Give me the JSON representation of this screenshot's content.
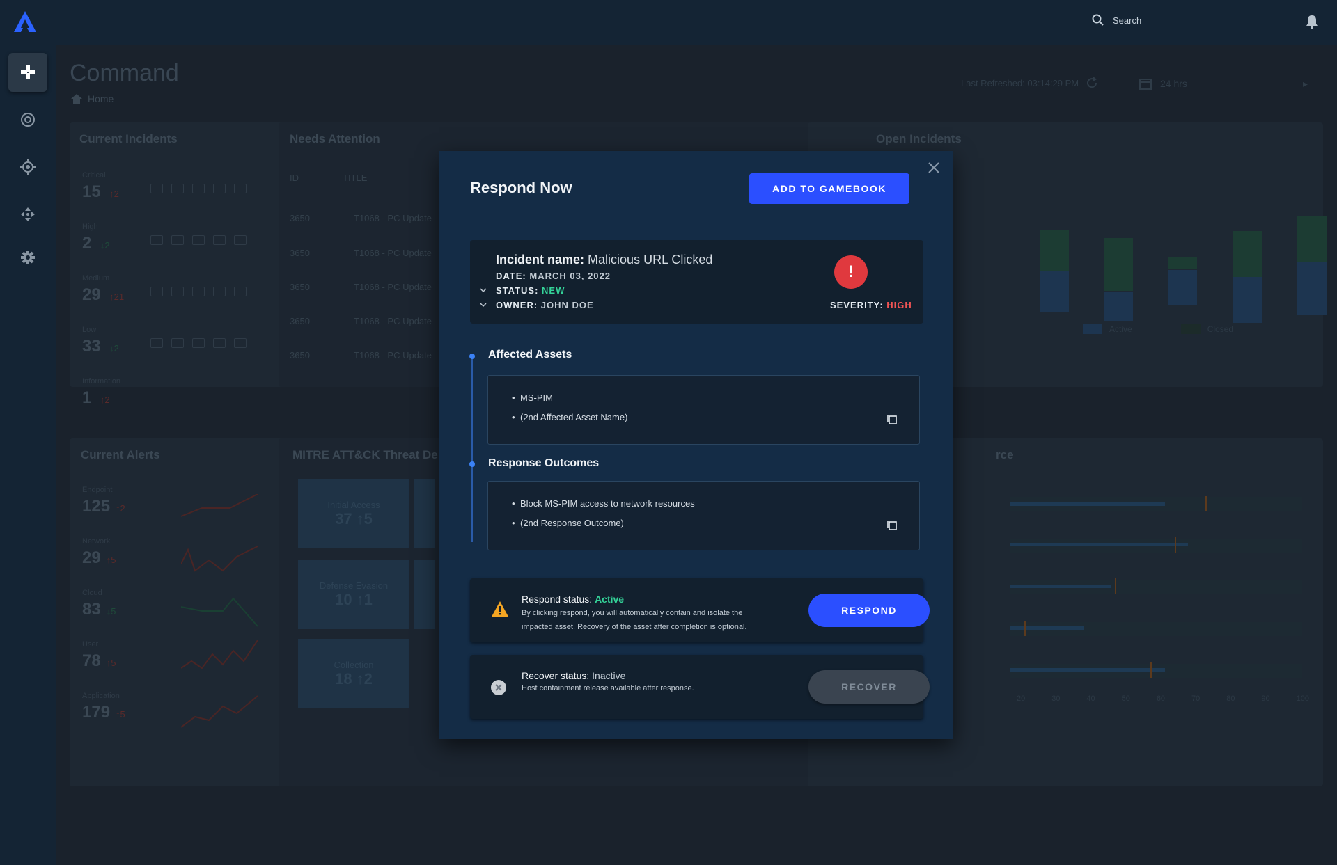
{
  "colors": {
    "accent": "#2b4fff",
    "active_green": "#34d399",
    "severity_red": "#e0393e",
    "warning_orange": "#f5a623"
  },
  "topbar": {
    "search_placeholder": "Search"
  },
  "dashboard": {
    "title": "Command",
    "breadcrumb": "Home",
    "last_refreshed": "Last Refreshed: 03:14:29 PM",
    "date_range": "24 hrs",
    "current_incidents": {
      "title": "Current Incidents",
      "rows": [
        {
          "label": "Critical",
          "count": "15",
          "delta": "2",
          "dir": "up"
        },
        {
          "label": "High",
          "count": "2",
          "delta": "2",
          "dir": "down"
        },
        {
          "label": "Medium",
          "count": "29",
          "delta": "21",
          "dir": "up"
        },
        {
          "label": "Low",
          "count": "33",
          "delta": "2",
          "dir": "down"
        },
        {
          "label": "Information",
          "count": "1",
          "delta": "2",
          "dir": "up"
        }
      ]
    },
    "needs_attention": {
      "title": "Needs Attention",
      "col_id": "ID",
      "col_title": "TITLE",
      "rows": [
        {
          "id": "3650",
          "title": "T1068 - PC Update"
        },
        {
          "id": "3650",
          "title": "T1068 - PC Update"
        },
        {
          "id": "3650",
          "title": "T1068 - PC Update"
        },
        {
          "id": "3650",
          "title": "T1068 - PC Update"
        },
        {
          "id": "3650",
          "title": "T1068 - PC Update"
        }
      ]
    },
    "open_incidents": {
      "title": "Open Incidents",
      "legend": [
        "Active",
        "Closed"
      ]
    },
    "current_alerts": {
      "title": "Current Alerts",
      "rows": [
        {
          "label": "Endpoint",
          "count": "125",
          "delta": "2",
          "dir": "up"
        },
        {
          "label": "Network",
          "count": "29",
          "delta": "5",
          "dir": "up"
        },
        {
          "label": "Cloud",
          "count": "83",
          "delta": "5",
          "dir": "down"
        },
        {
          "label": "User",
          "count": "78",
          "delta": "5",
          "dir": "up"
        },
        {
          "label": "Application",
          "count": "179",
          "delta": "5",
          "dir": "up"
        }
      ]
    },
    "mitre": {
      "title": "MITRE ATT&CK Threat De",
      "tiles": [
        {
          "name": "Initial Access",
          "value": "37 ↑5"
        },
        {
          "name": "Defense Evasion",
          "value": "10 ↑1"
        },
        {
          "name": "Collection",
          "value": "18 ↑2"
        }
      ]
    },
    "perf_title_fragment": "rce",
    "perf_axis": [
      "20",
      "30",
      "40",
      "50",
      "60",
      "70",
      "80",
      "90",
      "100"
    ]
  },
  "modal": {
    "title": "Respond Now",
    "add_button": "ADD TO GAMEBOOK",
    "incident": {
      "name_label": "Incident name",
      "name_value": "Malicious URL Clicked",
      "date_label": "DATE:",
      "date_value": "MARCH 03, 2022",
      "status_label": "STATUS:",
      "status_value": "NEW",
      "owner_label": "OWNER:",
      "owner_value": "JOHN DOE",
      "severity_label": "SEVERITY:",
      "severity_value": "HIGH"
    },
    "affected_assets": {
      "title": "Affected Assets",
      "items": [
        "MS-PIM",
        "(2nd Affected Asset Name)"
      ]
    },
    "response_outcomes": {
      "title": "Response Outcomes",
      "items": [
        "Block MS-PIM access to network resources",
        "(2nd Response Outcome)"
      ]
    },
    "respond": {
      "label": "Respond status:",
      "value": "Active",
      "desc": "By clicking respond, you will automatically contain and isolate the impacted asset. Recovery of the asset after completion is optional.",
      "button": "RESPOND"
    },
    "recover": {
      "label": "Recover status:",
      "value": "Inactive",
      "desc": "Host containment release available after response.",
      "button": "RECOVER"
    }
  }
}
